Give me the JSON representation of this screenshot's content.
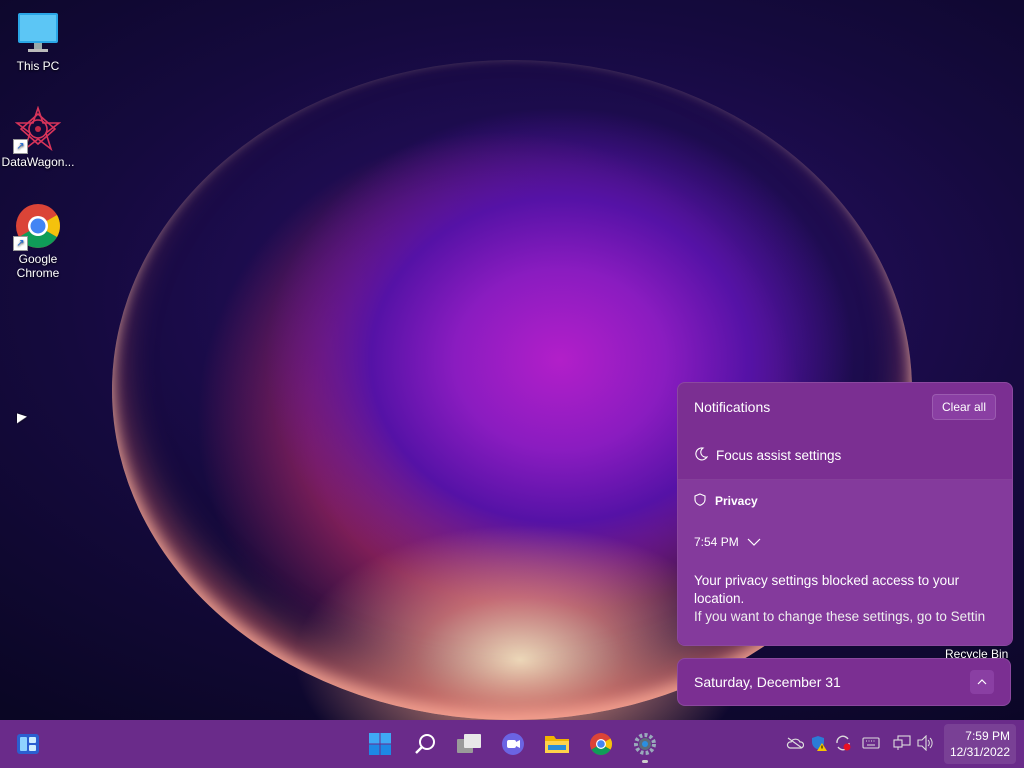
{
  "desktop": {
    "icons": [
      {
        "label": "This PC",
        "icon": "monitor-icon"
      },
      {
        "label": "DataWagon...",
        "icon": "datawagon-icon"
      },
      {
        "label": "Google Chrome",
        "icon": "chrome-icon"
      }
    ],
    "recycle_bin_label": "Recycle Bin"
  },
  "notifications": {
    "title": "Notifications",
    "clear_all_label": "Clear all",
    "focus_assist_label": "Focus assist settings",
    "card": {
      "app_name": "Privacy",
      "time": "7:54 PM",
      "body_line1": "Your privacy settings blocked access to your",
      "body_line2": "location.",
      "body_line3": "If you want to change these settings, go to Settin"
    }
  },
  "calendar": {
    "date_label": "Saturday, December 31"
  },
  "taskbar": {
    "clock_time": "7:59 PM",
    "clock_date": "12/31/2022",
    "apps": [
      "widgets-icon",
      "start-icon",
      "search-icon",
      "task-view-icon",
      "chat-icon",
      "file-explorer-icon",
      "chrome-icon",
      "settings-icon"
    ],
    "tray": [
      "onedrive-icon",
      "security-warning-icon",
      "update-icon",
      "keyboard-icon",
      "network-icon",
      "volume-icon"
    ]
  },
  "colors": {
    "flyout_bg": "#7b2f92",
    "taskbar_bg": "#6a2b8a",
    "accent": "#0078d4"
  }
}
